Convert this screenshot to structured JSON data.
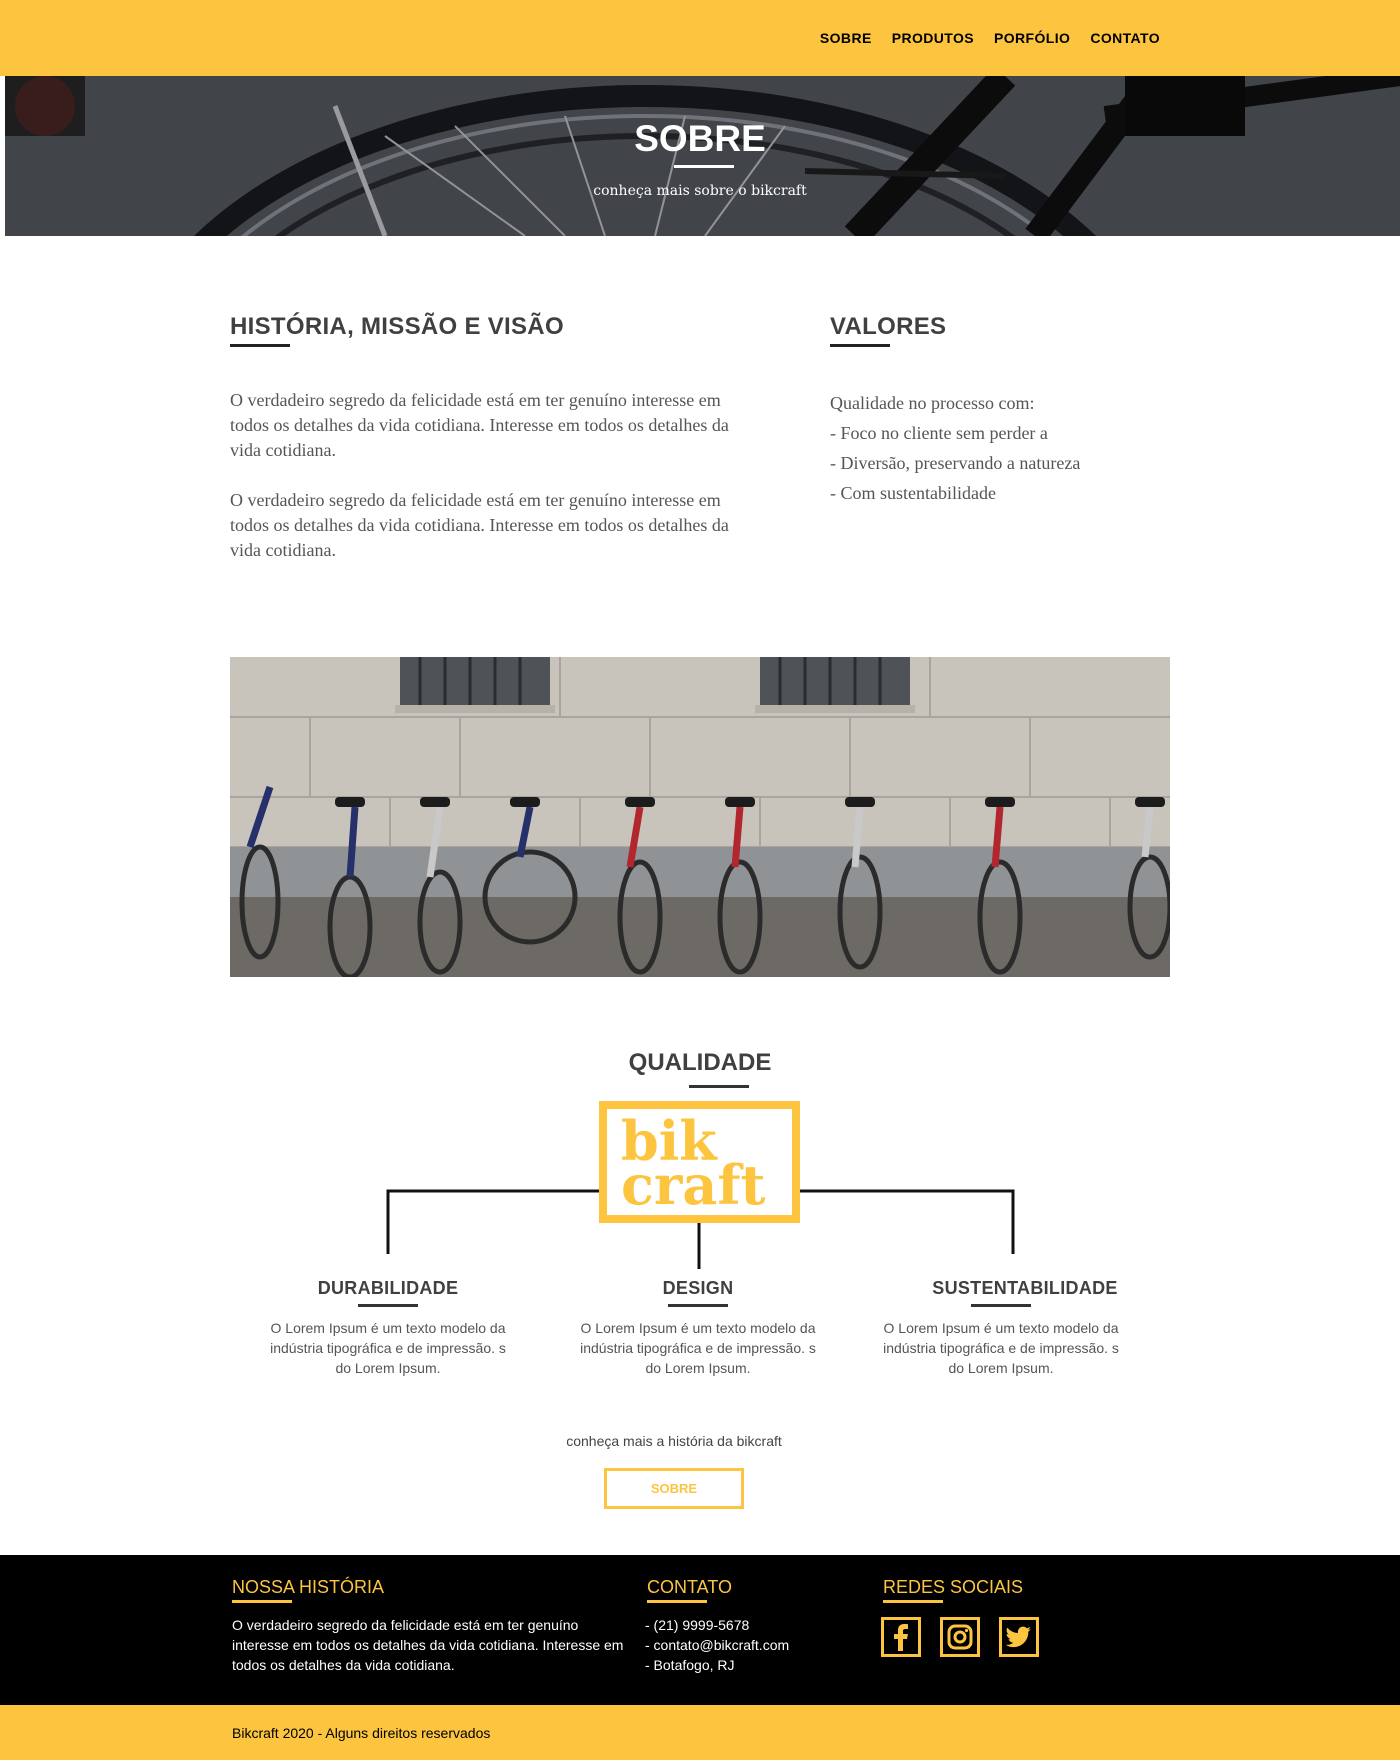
{
  "nav": {
    "items": [
      {
        "label": "SOBRE"
      },
      {
        "label": "PRODUTOS"
      },
      {
        "label": "PORFÓLIO"
      },
      {
        "label": "CONTATO"
      }
    ]
  },
  "hero": {
    "title": "SOBRE",
    "subtitle": "conheça mais sobre o bikcraft"
  },
  "about": {
    "history_title": "HISTÓRIA, MISSÃO E VISÃO",
    "history_paragraphs": [
      "O verdadeiro segredo da felicidade está em ter genuíno interesse em todos os detalhes da vida cotidiana. Interesse em todos os detalhes da vida cotidiana.",
      "O verdadeiro segredo da felicidade está em ter genuíno interesse em todos os detalhes da vida cotidiana. Interesse em todos os detalhes da vida cotidiana."
    ],
    "values_title": "VALORES",
    "values_lines": [
      "Qualidade no processo com:",
      "- Foco no cliente sem perder a",
      "- Diversão, preservando a natureza",
      "- Com sustentabilidade"
    ]
  },
  "quality": {
    "title": "QUALIDADE",
    "logo_line1": "bik",
    "logo_line2": "craft",
    "columns": [
      {
        "title": "DURABILIDADE",
        "text": "O Lorem Ipsum é um texto modelo da indústria tipográfica e de impressão. s do Lorem Ipsum."
      },
      {
        "title": "DESIGN",
        "text": "O Lorem Ipsum é um texto modelo da indústria tipográfica e de impressão. s do Lorem Ipsum."
      },
      {
        "title": "SUSTENTABILIDADE",
        "text": "O Lorem Ipsum é um texto modelo da indústria tipográfica e de impressão. s do Lorem Ipsum."
      }
    ],
    "more_text": "conheça mais a história da bikcraft",
    "button_label": "SOBRE"
  },
  "footer": {
    "history_title": "NOSSA HISTÓRIA",
    "history_text": "O verdadeiro segredo da felicidade está em ter genuíno interesse em todos os detalhes da vida cotidiana. Interesse em todos os detalhes da vida cotidiana.",
    "contact_title": "CONTATO",
    "contact_lines": [
      "- (21) 9999-5678",
      "- contato@bikcraft.com",
      "- Botafogo, RJ"
    ],
    "social_title": "REDES SOCIAIS",
    "social_icons": [
      "facebook-icon",
      "instagram-icon",
      "twitter-icon"
    ],
    "copyright": "Bikcraft 2020 - Alguns direitos reservados"
  },
  "colors": {
    "brand_yellow": "#fdc53f",
    "text_dark": "#404040",
    "footer_bg": "#000000"
  }
}
